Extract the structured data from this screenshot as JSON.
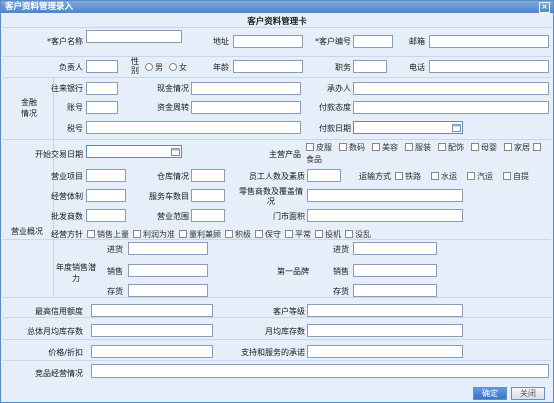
{
  "window": {
    "title": "客户资料管理录入",
    "close": "×"
  },
  "card_title": "客户资料管理卡",
  "basic": {
    "customer_name": "*客户名称",
    "address": "地址",
    "customer_code": "*客户编号",
    "postcode": "邮箱",
    "owner": "负责人",
    "gender": "性别",
    "male": "男",
    "female": "女",
    "age": "年龄",
    "position": "职务",
    "phone": "电话"
  },
  "finance": {
    "section": "金融情况",
    "bank": "往来银行",
    "cash": "现金情况",
    "acceptor": "承办人",
    "account": "账号",
    "turnover": "资金周转",
    "attitude": "付款态度",
    "tax_no": "税号",
    "pay_date": "付款日期"
  },
  "business": {
    "section": "营业概况",
    "first_trade_date": "开始交易日期",
    "main_products": "主营产品",
    "products": [
      "皮服",
      "数码",
      "美容",
      "服装",
      "配饰",
      "母婴",
      "家居",
      "食品"
    ],
    "business_items": "营业项目",
    "warehouse": "仓库情况",
    "staff_quality": "员工人数及素质",
    "transport": "运输方式",
    "transports": [
      "铁路",
      "水运",
      "汽运",
      "自提"
    ],
    "system": "经营体制",
    "service_cars": "服务车数目",
    "retailers": "零售商数及覆盖情况",
    "wholesalers": "批发商数",
    "scope": "营业范围",
    "store_area": "门市面积",
    "policy": "经营方针",
    "policies": [
      "销售上量",
      "利润为准",
      "量利兼顾",
      "积极",
      "保守",
      "平常",
      "投机",
      "没乱"
    ],
    "annual_potential": "年度销售潜力",
    "first_brand": "第一品牌",
    "purchase": "进货",
    "sales": "销售",
    "stock": "存货"
  },
  "credit": {
    "max_credit": "最高信用额度",
    "customer_level": "客户等级",
    "avg_stock": "总体月均库存数",
    "monthly_stock": "月均库存数",
    "price_discount": "价格/折扣",
    "support": "支持和服务的承诺",
    "competitors": "竞品经营情况"
  },
  "buttons": {
    "ok": "确定",
    "close": "关闭"
  }
}
